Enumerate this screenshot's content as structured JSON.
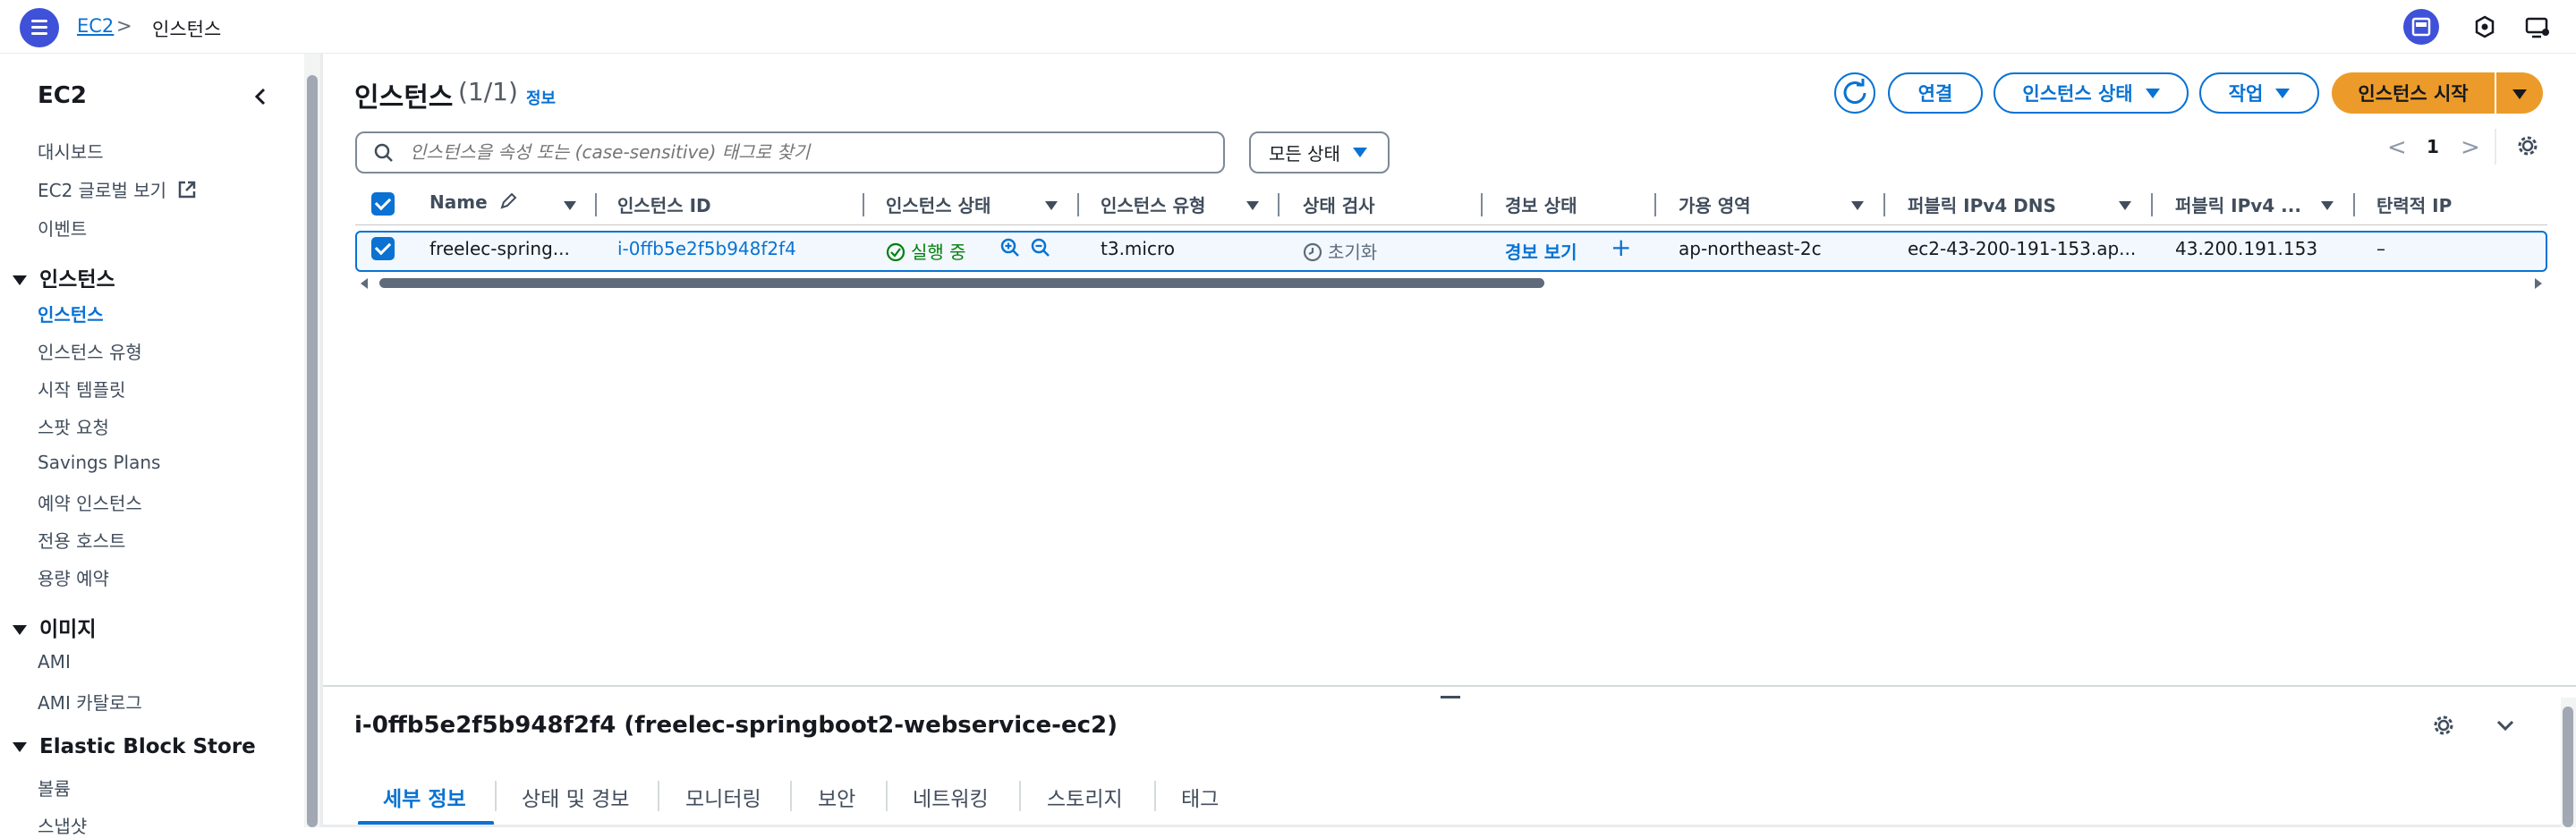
{
  "topbar": {
    "breadcrumb": {
      "service": "EC2",
      "separator": ">",
      "current": "인스턴스"
    },
    "icons": [
      "menu-icon",
      "split-panel-icon",
      "notifications-icon",
      "display-icon"
    ]
  },
  "sidebar": {
    "title": "EC2",
    "items_top": [
      "대시보드",
      "EC2 글로벌 보기",
      "이벤트"
    ],
    "sections": [
      {
        "label": "인스턴스",
        "items": [
          "인스턴스",
          "인스턴스 유형",
          "시작 템플릿",
          "스팟 요청",
          "Savings Plans",
          "예약 인스턴스",
          "전용 호스트",
          "용량 예약"
        ]
      },
      {
        "label": "이미지",
        "items": [
          "AMI",
          "AMI 카탈로그"
        ]
      },
      {
        "label": "Elastic Block Store",
        "items": [
          "볼륨",
          "스냅샷"
        ]
      }
    ],
    "active_item": "인스턴스"
  },
  "main": {
    "title": "인스턴스",
    "count": "(1/1)",
    "info": "정보",
    "actions": {
      "connect": "연결",
      "instance_state": "인스턴스 상태",
      "actions": "작업",
      "launch": "인스턴스 시작"
    },
    "search": {
      "placeholder": "인스턴스을 속성 또는 (case-sensitive) 태그로 찾기"
    },
    "status_filter": "모든 상태",
    "pagination": {
      "prev": "<",
      "page": "1",
      "next": ">"
    }
  },
  "table": {
    "columns": [
      "Name",
      "인스턴스 ID",
      "인스턴스 상태",
      "인스턴스 유형",
      "상태 검사",
      "경보 상태",
      "가용 영역",
      "퍼블릭 IPv4 DNS",
      "퍼블릭 IPv4 ...",
      "탄력적 IP"
    ],
    "rows": [
      {
        "name": "freelec-spring...",
        "instance_id": "i-0ffb5e2f5b948f2f4",
        "state": "실행 중",
        "type": "t3.micro",
        "status_check": "초기화",
        "alarm": "경보 보기",
        "alarm_add": "+",
        "az": "ap-northeast-2c",
        "public_dns": "ec2-43-200-191-153.ap...",
        "public_ip": "43.200.191.153",
        "elastic_ip": "–"
      }
    ]
  },
  "split_panel": {
    "title": "i-0ffb5e2f5b948f2f4 (freelec-springboot2-webservice-ec2)",
    "tabs": [
      "세부 정보",
      "상태 및 경보",
      "모니터링",
      "보안",
      "네트워킹",
      "스토리지",
      "태그"
    ],
    "active_tab": "세부 정보"
  },
  "colors": {
    "accent": "#0972d3",
    "launch": "#ec9b2a",
    "running": "#037f0c",
    "menu": "#3f51d8"
  }
}
